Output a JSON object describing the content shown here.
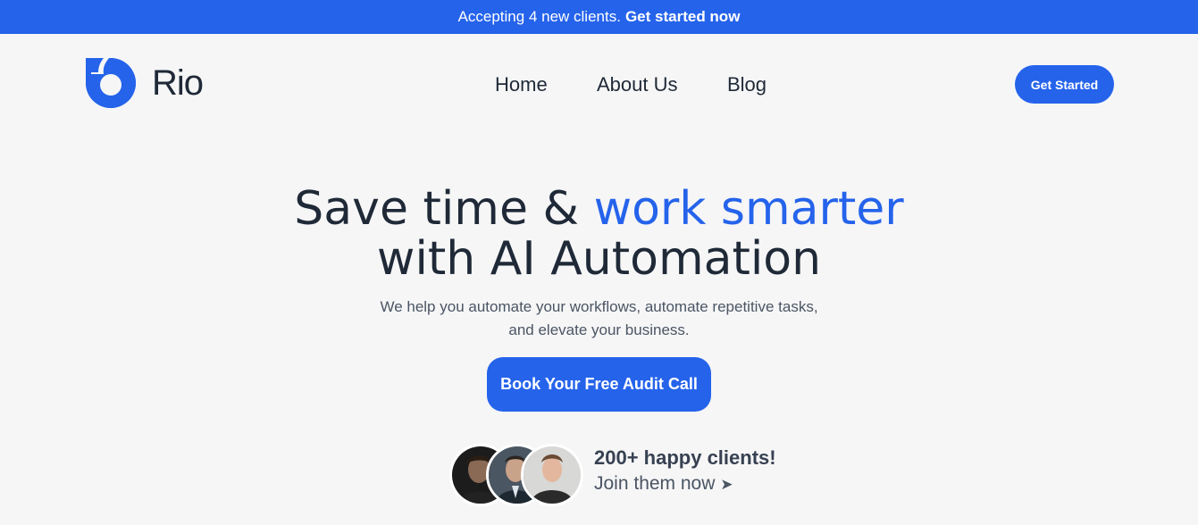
{
  "announcement": {
    "text": "Accepting 4 new clients.",
    "link": "Get started now"
  },
  "brand": {
    "name": "Rio",
    "logo_icon": "rio-logo-icon",
    "accent_color": "#2563eb"
  },
  "nav": {
    "items": [
      "Home",
      "About Us",
      "Blog"
    ]
  },
  "header": {
    "cta_label": "Get Started"
  },
  "hero": {
    "title_part1": "Save time & ",
    "title_accent": "work smarter",
    "title_line2": "with AI Automation",
    "subtitle": "We help you automate your workflows, automate repetitive tasks, and elevate your business.",
    "cta_label": "Book Your Free Audit Call"
  },
  "social_proof": {
    "title": "200+ happy clients!",
    "join_text": "Join them now",
    "arrow_icon": "arrow-right-icon",
    "avatars": [
      "client-avatar-1",
      "client-avatar-2",
      "client-avatar-3"
    ]
  }
}
